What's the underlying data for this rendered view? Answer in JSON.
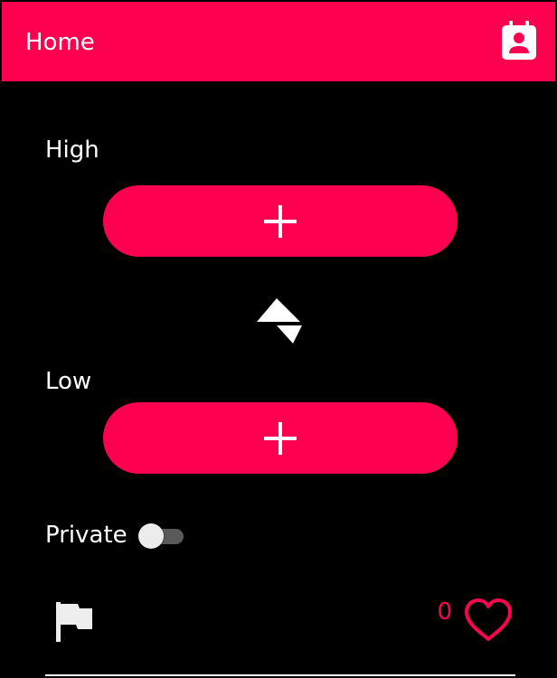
{
  "appbar": {
    "title": "Home",
    "action_icon": "contact-calendar-icon",
    "color": "#ff0050"
  },
  "high": {
    "label": "High",
    "add_icon": "plus-icon"
  },
  "swap": {
    "icon": "swap-icon"
  },
  "low": {
    "label": "Low",
    "add_icon": "plus-icon"
  },
  "private": {
    "label": "Private",
    "enabled": false
  },
  "footer": {
    "flag_icon": "flag-icon",
    "like_count": "0",
    "like_icon": "heart-outline-icon"
  },
  "colors": {
    "accent": "#ff0050",
    "background": "#000000",
    "text": "#ffffff"
  }
}
